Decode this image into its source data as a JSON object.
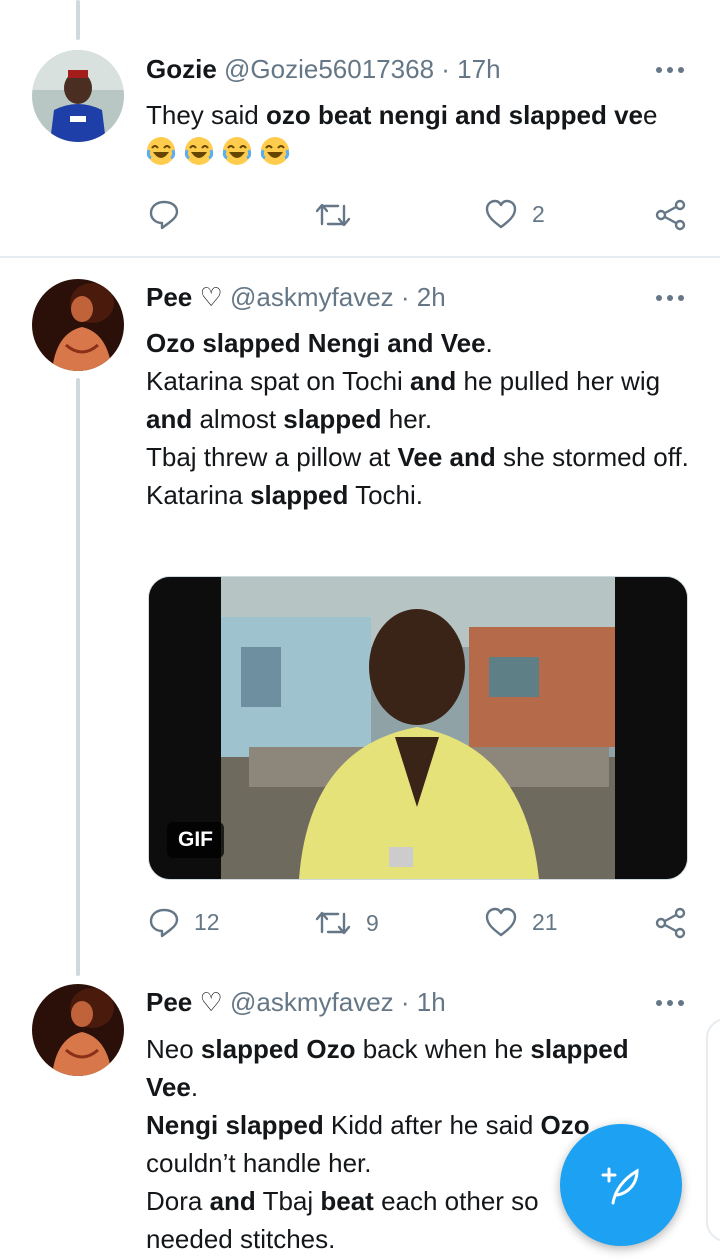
{
  "tweets": [
    {
      "name": "Gozie",
      "handle": "@Gozie56017368",
      "time": "· 17h",
      "lines": [
        [
          {
            "t": "They said ",
            "b": false
          },
          {
            "t": "ozo beat nengi and slapped ve",
            "b": true
          },
          {
            "t": "e",
            "b": false
          }
        ]
      ],
      "emojis": [
        "😂",
        "😂",
        "😂",
        "😂"
      ],
      "reply_count": "",
      "retweet_count": "",
      "like_count": "2"
    },
    {
      "name": "Pee ♡",
      "handle": "@askmyfavez",
      "time": "· 2h",
      "lines": [
        [
          {
            "t": "Ozo slapped Nengi and Vee",
            "b": true
          },
          {
            "t": ".",
            "b": false
          }
        ],
        [
          {
            "t": "Katarina spat on Tochi ",
            "b": false
          },
          {
            "t": "and",
            "b": true
          },
          {
            "t": " he pulled her wig ",
            "b": false
          },
          {
            "t": "and",
            "b": true
          },
          {
            "t": " almost ",
            "b": false
          },
          {
            "t": "slapped",
            "b": true
          },
          {
            "t": " her.",
            "b": false
          }
        ],
        [
          {
            "t": "Tbaj threw a pillow at ",
            "b": false
          },
          {
            "t": "Vee and",
            "b": true
          },
          {
            "t": " she stormed off.",
            "b": false
          }
        ],
        [
          {
            "t": "Katarina ",
            "b": false
          },
          {
            "t": "slapped",
            "b": true
          },
          {
            "t": " Tochi.",
            "b": false
          }
        ]
      ],
      "media_badge": "GIF",
      "reply_count": "12",
      "retweet_count": "9",
      "like_count": "21"
    },
    {
      "name": "Pee ♡",
      "handle": "@askmyfavez",
      "time": "· 1h",
      "lines": [
        [
          {
            "t": "Neo ",
            "b": false
          },
          {
            "t": "slapped Ozo",
            "b": true
          },
          {
            "t": " back when he ",
            "b": false
          },
          {
            "t": "slapped Vee",
            "b": true
          },
          {
            "t": ".",
            "b": false
          }
        ],
        [
          {
            "t": "Nengi slapped",
            "b": true
          },
          {
            "t": " Kidd after he said ",
            "b": false
          },
          {
            "t": "Ozo",
            "b": true
          },
          {
            "t": " couldn’t handle her.",
            "b": false
          }
        ],
        [
          {
            "t": "Dora ",
            "b": false
          },
          {
            "t": "and",
            "b": true
          },
          {
            "t": " Tbaj ",
            "b": false
          },
          {
            "t": "beat",
            "b": true
          },
          {
            "t": " each other so",
            "b": false
          }
        ],
        [
          {
            "t": "needed stitches.",
            "b": false
          }
        ]
      ]
    }
  ],
  "icons": {
    "reply": "reply-icon",
    "retweet": "retweet-icon",
    "like": "heart-icon",
    "share": "share-icon",
    "more": "more-icon",
    "compose": "compose-tweet-icon"
  },
  "colors": {
    "accent": "#1da1f2",
    "muted": "#657786",
    "divider": "#e6ecf0"
  }
}
